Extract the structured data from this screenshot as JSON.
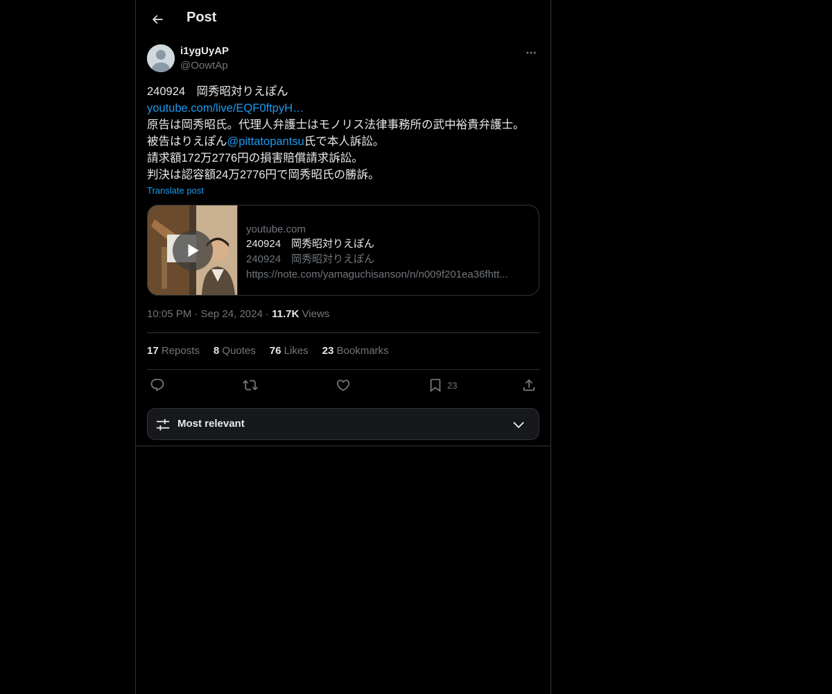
{
  "header": {
    "title": "Post"
  },
  "post": {
    "author_name": "i1ygUyAP",
    "author_handle": "@OowtAp",
    "text_line1": "240924　岡秀昭対りえぽん",
    "link_text": "youtube.com/live/EQF0ftpyH…",
    "text_line3": "原告は岡秀昭氏。代理人弁護士はモノリス法律事務所の武中裕貴弁護士。",
    "text_line4_before": "被告はりえぽん",
    "mention": "@pittatopantsu",
    "text_line4_after": "氏で本人訴訟。",
    "text_line5": "請求額172万2776円の損害賠償請求訴訟。",
    "text_line6": "判決は認容額24万2776円で岡秀昭氏の勝訴。",
    "translate_label": "Translate post",
    "card": {
      "domain": "youtube.com",
      "title": "240924　岡秀昭対りえぽん",
      "desc1": "240924　岡秀昭対りえぽん",
      "desc2": "https://note.com/yamaguchisanson/n/n009f201ea36fhtt..."
    },
    "time": "10:05 PM",
    "date": "Sep 24, 2024",
    "views_count": "11.7K",
    "views_label": "Views",
    "sep": "·"
  },
  "stats": {
    "reposts_count": "17",
    "reposts_label": "Reposts",
    "quotes_count": "8",
    "quotes_label": "Quotes",
    "likes_count": "76",
    "likes_label": "Likes",
    "bookmarks_count": "23",
    "bookmarks_label": "Bookmarks"
  },
  "actions": {
    "bookmark_count": "23"
  },
  "sort": {
    "label": "Most relevant"
  },
  "icons": {
    "back": "arrow-left-icon",
    "more": "ellipsis-icon",
    "play": "play-icon",
    "reply": "reply-icon",
    "repost": "repost-icon",
    "like": "heart-icon",
    "bookmark": "bookmark-icon",
    "share": "share-icon",
    "sliders": "sliders-icon",
    "chevron": "chevron-down-icon"
  },
  "colors": {
    "accent": "#1d9bf0",
    "background": "#000000",
    "text": "#e7e9ea",
    "muted": "#71767b",
    "border": "#2f3336"
  }
}
